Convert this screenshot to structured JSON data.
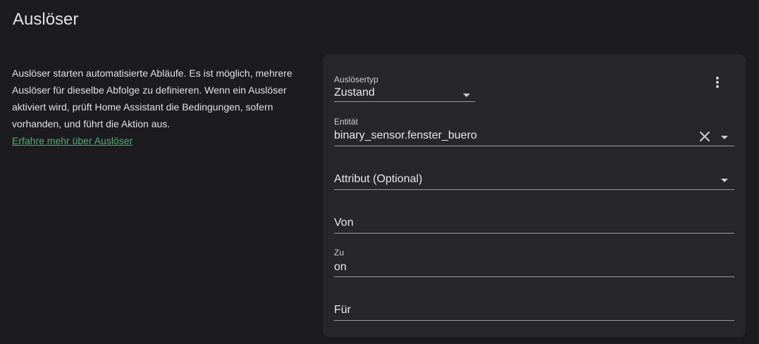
{
  "section": {
    "title": "Auslöser"
  },
  "intro": {
    "text": "Auslöser starten automatisierte Abläufe. Es ist möglich, mehrere Auslöser für dieselbe Abfolge zu definieren. Wenn ein Auslöser aktiviert wird, prüft Home Assistant die Bedingungen, sofern vorhanden, und führt die Aktion aus.",
    "link": "Erfahre mehr über Auslöser"
  },
  "trigger": {
    "type_label": "Auslösertyp",
    "type_value": "Zustand",
    "entity_label": "Entität",
    "entity_value": "binary_sensor.fenster_buero",
    "attribute_placeholder": "Attribut (Optional)",
    "from_placeholder": "Von",
    "to_label": "Zu",
    "to_value": "on",
    "for_placeholder": "Für"
  },
  "colors": {
    "background": "#1c1c1e",
    "card": "#27272a",
    "link": "#4caf73"
  },
  "icons": {
    "menu": "dots-vertical-icon",
    "clear": "close-icon",
    "dropdown": "menu-down-icon"
  }
}
